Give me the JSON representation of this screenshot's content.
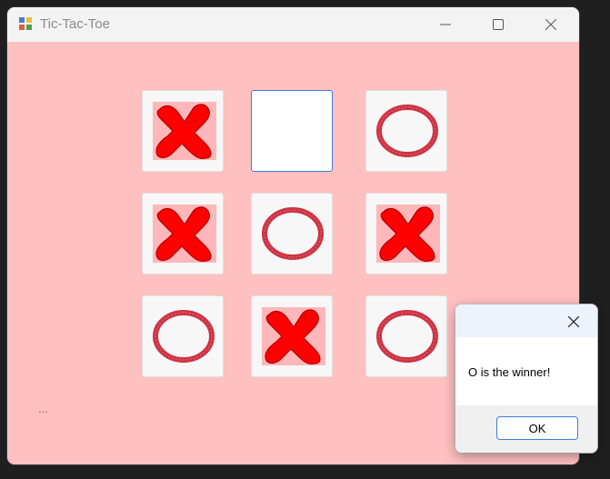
{
  "window": {
    "title": "Tic-Tac-Toe",
    "icon": "app-icon",
    "controls": [
      "minimize-icon",
      "maximize-icon",
      "close-icon"
    ]
  },
  "board": {
    "cells": [
      {
        "row": 1,
        "col": 1,
        "mark": "X"
      },
      {
        "row": 1,
        "col": 2,
        "mark": ""
      },
      {
        "row": 1,
        "col": 3,
        "mark": "O"
      },
      {
        "row": 2,
        "col": 1,
        "mark": "X"
      },
      {
        "row": 2,
        "col": 2,
        "mark": "O"
      },
      {
        "row": 2,
        "col": 3,
        "mark": "X"
      },
      {
        "row": 3,
        "col": 1,
        "mark": "O"
      },
      {
        "row": 3,
        "col": 2,
        "mark": "X"
      },
      {
        "row": 3,
        "col": 3,
        "mark": "O"
      }
    ]
  },
  "status": {
    "text": "..."
  },
  "dialog": {
    "message": "O is the winner!",
    "ok_label": "OK"
  },
  "colors": {
    "background": "#ffc0c0",
    "x_mark": "#ff0000",
    "o_mark": "#cc3344",
    "accent": "#3f7fdc"
  }
}
